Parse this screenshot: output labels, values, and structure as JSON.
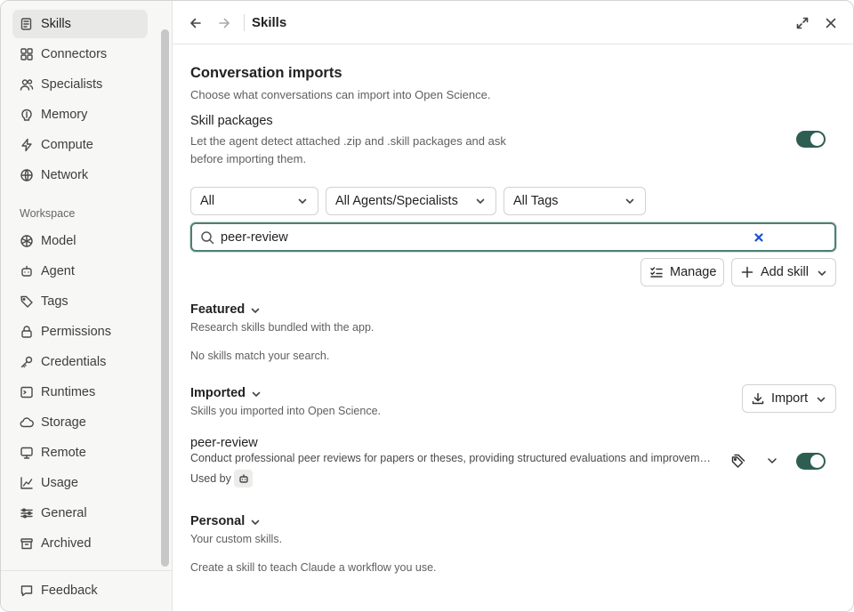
{
  "sidebar": {
    "items": [
      {
        "label": "Skills",
        "icon": "skills-icon",
        "active": true
      },
      {
        "label": "Connectors",
        "icon": "connectors-icon"
      },
      {
        "label": "Specialists",
        "icon": "specialists-icon"
      },
      {
        "label": "Memory",
        "icon": "memory-icon"
      },
      {
        "label": "Compute",
        "icon": "compute-icon"
      },
      {
        "label": "Network",
        "icon": "globe-icon"
      }
    ],
    "workspace_label": "Workspace",
    "workspace_items": [
      {
        "label": "Model",
        "icon": "model-icon"
      },
      {
        "label": "Agent",
        "icon": "agent-icon"
      },
      {
        "label": "Tags",
        "icon": "tag-icon"
      },
      {
        "label": "Permissions",
        "icon": "lock-icon"
      },
      {
        "label": "Credentials",
        "icon": "key-icon"
      },
      {
        "label": "Runtimes",
        "icon": "terminal-icon"
      },
      {
        "label": "Storage",
        "icon": "cloud-icon"
      },
      {
        "label": "Remote",
        "icon": "remote-icon"
      },
      {
        "label": "Usage",
        "icon": "chart-icon"
      },
      {
        "label": "General",
        "icon": "sliders-icon"
      },
      {
        "label": "Archived",
        "icon": "archive-icon"
      }
    ],
    "feedback_label": "Feedback"
  },
  "header": {
    "title": "Skills"
  },
  "conversation_imports": {
    "title": "Conversation imports",
    "subtitle": "Choose what conversations can import into Open Science.",
    "skill_packages_label": "Skill packages",
    "skill_packages_desc_line1": "Let the agent detect attached .zip and .skill packages and ask",
    "skill_packages_desc_line2": "before importing them.",
    "skill_packages_enabled": true
  },
  "filters": {
    "type": "All",
    "agents": "All Agents/Specialists",
    "tags": "All Tags"
  },
  "search": {
    "value": "peer-review"
  },
  "actions": {
    "manage_label": "Manage",
    "add_skill_label": "Add skill"
  },
  "featured": {
    "title": "Featured",
    "desc": "Research skills bundled with the app.",
    "empty": "No skills match your search."
  },
  "imported": {
    "title": "Imported",
    "desc": "Skills you imported into Open Science.",
    "import_label": "Import",
    "skills": [
      {
        "name": "peer-review",
        "description": "Conduct professional peer reviews for papers or theses, providing structured evaluations and improvement suggestions.",
        "used_by_label": "Used by",
        "enabled": true
      }
    ]
  },
  "personal": {
    "title": "Personal",
    "desc": "Your custom skills.",
    "empty": "Create a skill to teach Claude a workflow you use."
  },
  "colors": {
    "accent": "#2e5e52",
    "focus_border": "#4f7f74",
    "clear_icon": "#1d4ed8"
  }
}
